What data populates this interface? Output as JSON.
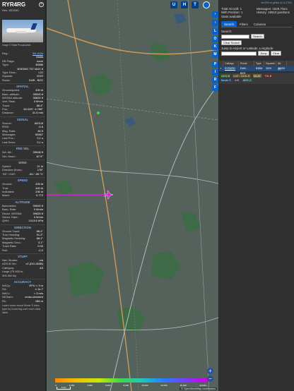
{
  "aircraft": {
    "callsign": "RYR4RG",
    "hex_label": "Hex: 4D234C",
    "photo_credit": "Image © Rafal Pruszkowski",
    "reg_label": "Reg.:",
    "reg": "9H-VUN",
    "country": "Malta",
    "db_flags_label": "DB Flags:",
    "db_flags": "none",
    "type_label": "Type:",
    "type": "B38M",
    "type_name": "BOEING 737 MAX 8",
    "type_desc_label": "Type Desc.:",
    "type_desc": "L2J",
    "squawk_label": "Squawk:",
    "squawk": "2020",
    "route_label": "Route:",
    "route": "DUB - BZG"
  },
  "sections": {
    "spatial": "SPATIAL",
    "signal": "SIGNAL",
    "fms_sel": "FMS SEL",
    "wind": "WIND",
    "speed": "SPEED",
    "altitude": "ALTITUDE",
    "direction": "DIRECTION",
    "stuff": "STUFF",
    "accuracy": "ACCURACY"
  },
  "spatial": [
    {
      "k": "Groundspeed:",
      "v": "439 kt"
    },
    {
      "k": "Baro. altitude:",
      "v": "39000 ft"
    },
    {
      "k": "WGS84 altitude:",
      "v": "39825 ft"
    },
    {
      "k": "Vert. Rate:",
      "v": "0 ft/min"
    },
    {
      "k": "Track:",
      "v": "88.4°"
    },
    {
      "k": "Pos.:",
      "v": "53.028°, 6.765°"
    },
    {
      "k": "Distance:",
      "v": "31.6 nmi"
    }
  ],
  "signal": [
    {
      "k": "Source:",
      "v": "ADS-B"
    },
    {
      "k": "RSSI:",
      "v": "-5.5"
    },
    {
      "k": "Msg. Rate:",
      "v": "46.5"
    },
    {
      "k": "Messages:",
      "v": "50967"
    },
    {
      "k": "Last Pos.:",
      "v": "0.1 s"
    },
    {
      "k": "Last Seen:",
      "v": "0.1 s"
    }
  ],
  "fms": [
    {
      "k": "Sel. Alt.:",
      "v": "39008 ft"
    },
    {
      "k": "Sel. Head.:",
      "v": "87.9°"
    }
  ],
  "wind": [
    {
      "k": "Speed:",
      "v": "21 kt"
    },
    {
      "k": "Direction (from):",
      "v": "178°"
    },
    {
      "k": "TAT / OAT:",
      "v": "-34 / -59 °C"
    }
  ],
  "speed": [
    {
      "k": "Ground:",
      "v": "439 kt"
    },
    {
      "k": "True:",
      "v": "440 kt"
    },
    {
      "k": "Indicated:",
      "v": "236 kt"
    },
    {
      "k": "Mach:",
      "v": "0.772"
    }
  ],
  "altitude": [
    {
      "k": "Barometric:",
      "v": "39000 ft"
    },
    {
      "k": "Baro. Rate:",
      "v": "0 ft/min"
    },
    {
      "k": "Geom. WGS84:",
      "v": "39825 ft"
    },
    {
      "k": "Geom. Rate:",
      "v": "0 ft/min"
    },
    {
      "k": "QNH:",
      "v": "1013.6 hPa"
    }
  ],
  "direction": [
    {
      "k": "Ground Track:",
      "v": "88.4°"
    },
    {
      "k": "True Heading:",
      "v": "91.2°"
    },
    {
      "k": "Magnetic Heading:",
      "v": "88.1°"
    },
    {
      "k": "Magnetic Decl.:",
      "v": "3.1°"
    },
    {
      "k": "Track Rate:",
      "v": "0.00"
    },
    {
      "k": "Roll:",
      "v": "-0.2"
    }
  ],
  "stuff": [
    {
      "k": "Nav. Modes:",
      "v": "n/a"
    },
    {
      "k": "ADS-B Ver.:",
      "v": "v2 (DO-260B)"
    },
    {
      "k": "Category:",
      "v": "A3"
    },
    {
      "k": "Large (75 000 to",
      "v": ""
    },
    {
      "k": "300 000 lb)",
      "v": ""
    }
  ],
  "accuracy": [
    {
      "k": "NACp:",
      "v": "EPU < 3 m"
    },
    {
      "k": "SIL:",
      "v": "≤ 1e-7"
    },
    {
      "k": "NACv:",
      "v": "< 3 m/s"
    },
    {
      "k": "NICbaro:",
      "v": "cross-checked"
    },
    {
      "k": "Rc:",
      "v": "186 m"
    }
  ],
  "footer": "Learn more about Mode S data type by hovering over each data label.",
  "map": {
    "buttons": [
      "U",
      "H",
      "T"
    ],
    "side_buttons": [
      "L",
      "O",
      "K",
      "M",
      "P",
      "I",
      "R",
      "F"
    ],
    "zoom_in": "+",
    "zoom_out": "−",
    "scale": "5 km",
    "attribution": "© OpenStreetMap contributors",
    "legend": [
      "0",
      "2,000",
      "4,000",
      "6,000",
      "8,000",
      "10,000",
      "20,000",
      "30,000",
      "40,000+"
    ]
  },
  "right": {
    "version": "tar1090 on github (3.14.1701)",
    "total_aircraft": "Total Aircraft: 1",
    "with_position": "With Position: 1",
    "stats_available": "Stats available",
    "messages": "Messages: 1829.7/sec",
    "history": "History: 19910 positions",
    "tabs": [
      "Search",
      "Filters",
      "Columns"
    ],
    "search_label": "Search:",
    "search_button": "Search",
    "clear_search": "Clear Search",
    "jump_label": "Jump to Airport or Latitude, Longitude:",
    "jump_button": "Jump",
    "clear_button": "Clear",
    "columns": [
      "Callsign",
      "Route",
      "Type",
      "Squawk",
      "Alt. (ft)"
    ],
    "row": {
      "callsign": "RYR4RG",
      "route": "DUB - BZG",
      "type": "B38M",
      "squawk": "2020",
      "alt": "39000"
    },
    "sources": [
      "ADS-B",
      "UAT / ADS-R",
      "MLAT",
      "TIS-B",
      "Mode S",
      "AIS",
      "ADS-C"
    ]
  }
}
